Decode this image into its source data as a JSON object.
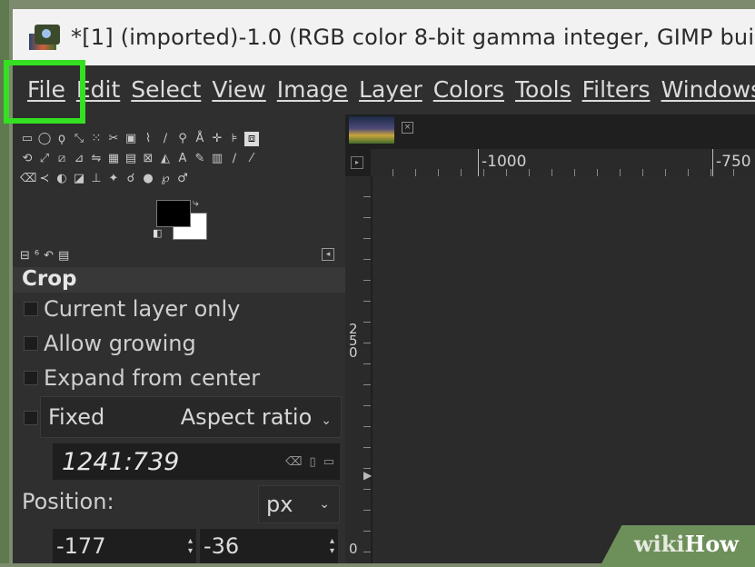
{
  "window": {
    "title": "*[1] (imported)-1.0 (RGB color 8-bit gamma integer, GIMP bui"
  },
  "menubar": {
    "items": [
      "File",
      "Edit",
      "Select",
      "View",
      "Image",
      "Layer",
      "Colors",
      "Tools",
      "Filters",
      "Windows"
    ],
    "highlighted": "File"
  },
  "tool_options": {
    "title": "Crop",
    "current_layer_only": "Current layer only",
    "allow_growing": "Allow growing",
    "expand_from_center": "Expand from center",
    "fixed_label": "Fixed",
    "fixed_mode": "Aspect ratio",
    "ratio_value": "1241:739",
    "position_label": "Position:",
    "position_unit": "px",
    "position_x": "-177",
    "position_y": "-36"
  },
  "rulers": {
    "h_label_1": "-1000",
    "h_label_2": "-750",
    "v_label": "250",
    "v_label_bottom": "0"
  },
  "watermark": {
    "part1": "wiki",
    "part2": "How"
  },
  "colors": {
    "highlight": "#34e021",
    "panel": "#2f2f2f",
    "canvas": "#2b2b2b"
  }
}
